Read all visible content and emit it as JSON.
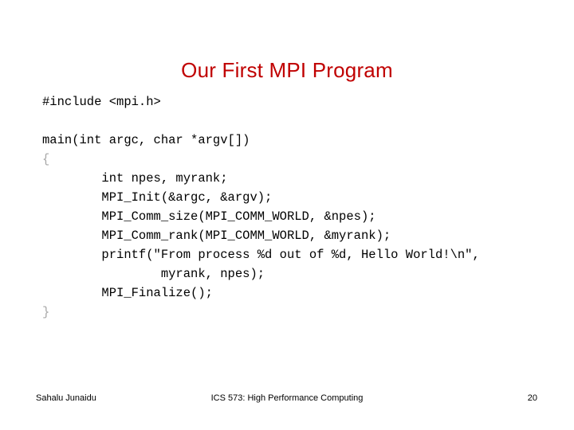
{
  "slide": {
    "title": "Our First MPI Program",
    "title_color": "#C00000",
    "background_color": "#FFFFFF",
    "code_color": "#000000"
  },
  "code": {
    "language": "c",
    "lines": [
      "#include <mpi.h>",
      "",
      "main(int argc, char *argv[])",
      "{",
      "        int npes, myrank;",
      "        MPI_Init(&argc, &argv);",
      "        MPI_Comm_size(MPI_COMM_WORLD, &npes);",
      "        MPI_Comm_rank(MPI_COMM_WORLD, &myrank);",
      "        printf(\"From process %d out of %d, Hello World!\\n\",",
      "                myrank, npes);",
      "        MPI_Finalize();",
      "}"
    ]
  },
  "footer": {
    "author": "Sahalu Junaidu",
    "course": "ICS 573: High Performance Computing",
    "page_number": "20"
  }
}
